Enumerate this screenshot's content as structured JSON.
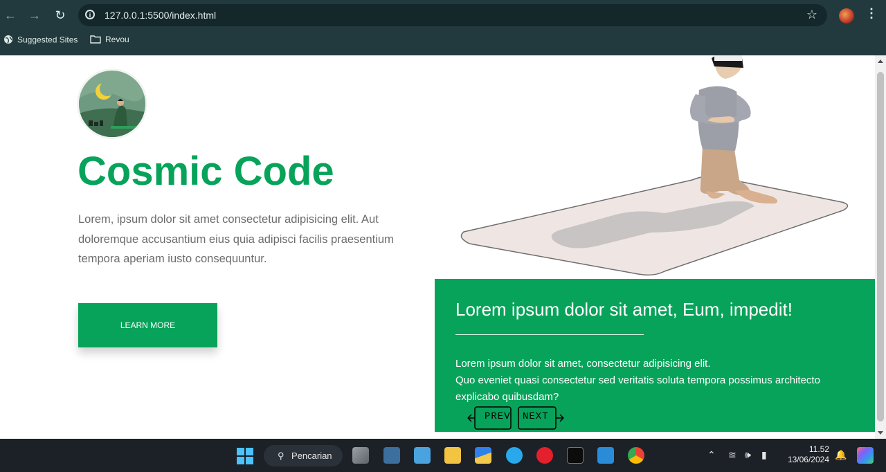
{
  "browser": {
    "url": "127.0.0.1:5500/index.html",
    "bookmarks": [
      "Suggested Sites",
      "Revou"
    ]
  },
  "hero": {
    "title": "Cosmic Code",
    "lead": "Lorem, ipsum dolor sit amet consectetur adipisicing elit. Aut doloremque accusantium eius quia adipisci facilis praesentium tempora aperiam iusto consequuntur.",
    "button": "LEARN MORE"
  },
  "card": {
    "title": "Lorem ipsum dolor sit amet, Eum, impedit!",
    "line1": "Lorem ipsum dolor sit amet, consectetur adipisicing elit.",
    "line2": "Quo eveniet quasi consectetur sed veritatis soluta tempora possimus architecto explicabo quibusdam?",
    "prev": "PREV",
    "next": "NEXT"
  },
  "taskbar": {
    "search": "Pencarian",
    "time": "11.52",
    "date": "13/06/2024"
  },
  "colors": {
    "brand_green": "#07a35a",
    "chrome_bg": "#223a3d",
    "taskbar_bg": "#1c2127"
  }
}
